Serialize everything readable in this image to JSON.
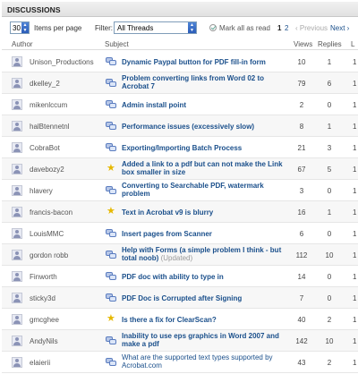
{
  "header": {
    "title": "DISCUSSIONS"
  },
  "toolbar": {
    "per_page_value": "30",
    "per_page_label": "Items per page",
    "filter_label": "Filter:",
    "filter_value": "All Threads",
    "mark_all_read": "Mark all as read",
    "pages": [
      "1",
      "2"
    ],
    "current_page": "1",
    "prev_label": "‹ Previous",
    "next_label": "Next ›"
  },
  "columns": {
    "author": "Author",
    "subject": "Subject",
    "views": "Views",
    "replies": "Replies",
    "last": "L"
  },
  "rows": [
    {
      "author": "Unison_Productions",
      "subject": "Dynamic Paypal button for PDF fill-in form",
      "views": "10",
      "replies": "1",
      "last": "1",
      "icon": "discussion-icon"
    },
    {
      "author": "dkelley_2",
      "subject": "Problem converting links from Word 02 to Acrobat 7",
      "views": "79",
      "replies": "6",
      "last": "1",
      "icon": "discussion-icon"
    },
    {
      "author": "mikenlccum",
      "subject": "Admin install point",
      "views": "2",
      "replies": "0",
      "last": "1",
      "icon": "discussion-icon"
    },
    {
      "author": "halBtennetnl",
      "subject": "Performance issues (excessively slow)",
      "views": "8",
      "replies": "1",
      "last": "1",
      "icon": "discussion-icon"
    },
    {
      "author": "CobraBot",
      "subject": "Exporting/Importing Batch Process",
      "views": "21",
      "replies": "3",
      "last": "1",
      "icon": "discussion-icon"
    },
    {
      "author": "davebozy2",
      "subject": "Added a link to a pdf but can not make the Link box smaller in size",
      "views": "67",
      "replies": "5",
      "last": "1",
      "icon": "star-icon"
    },
    {
      "author": "hlavery",
      "subject": "Converting to Searchable PDF, watermark problem",
      "views": "3",
      "replies": "0",
      "last": "1",
      "icon": "discussion-icon"
    },
    {
      "author": "francis-bacon",
      "subject": "Text in Acrobat v9 is blurry",
      "views": "16",
      "replies": "1",
      "last": "1",
      "icon": "star-icon"
    },
    {
      "author": "LouisMMC",
      "subject": "Insert pages from Scanner",
      "views": "6",
      "replies": "0",
      "last": "1",
      "icon": "discussion-icon"
    },
    {
      "author": "gordon robb",
      "subject": "Help with Forms (a simple problem I think - but total noob)",
      "updated": "(Updated)",
      "views": "112",
      "replies": "10",
      "last": "1",
      "icon": "discussion-icon"
    },
    {
      "author": "Finworth",
      "subject": "PDF doc with ability to type in",
      "views": "14",
      "replies": "0",
      "last": "1",
      "icon": "discussion-icon"
    },
    {
      "author": "sticky3d",
      "subject": "PDF Doc is Corrupted after Signing",
      "views": "7",
      "replies": "0",
      "last": "1",
      "icon": "discussion-icon"
    },
    {
      "author": "gmcghee",
      "subject": "Is there a fix for ClearScan?",
      "views": "40",
      "replies": "2",
      "last": "1",
      "icon": "star-icon"
    },
    {
      "author": "AndyNils",
      "subject": "Inability to use eps graphics in Word 2007 and make a pdf",
      "views": "142",
      "replies": "10",
      "last": "1",
      "icon": "discussion-icon"
    },
    {
      "author": "elaierii",
      "subject": "What are the supported text types supported by Acrobat.com",
      "views": "43",
      "replies": "2",
      "last": "1",
      "icon": "discussion-icon",
      "plain": true
    }
  ]
}
